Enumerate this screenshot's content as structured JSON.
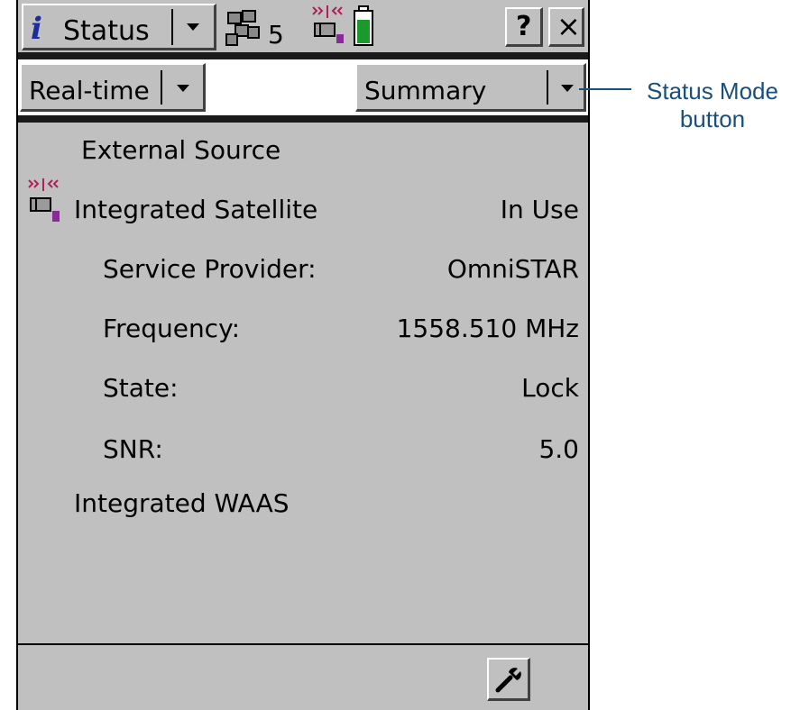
{
  "titlebar": {
    "app_label": "Status",
    "satellite_count": "5",
    "help_label": "?",
    "close_label": "×"
  },
  "toolbar": {
    "mode_left": "Real-time",
    "mode_right": "Summary"
  },
  "content": {
    "external_source": "External Source",
    "integrated_satellite": {
      "label": "Integrated Satellite",
      "status": "In Use",
      "rows": [
        {
          "label": "Service Provider:",
          "value": "OmniSTAR"
        },
        {
          "label": "Frequency:",
          "value": "1558.510 MHz"
        },
        {
          "label": "State:",
          "value": "Lock"
        },
        {
          "label": "SNR:",
          "value": "5.0"
        }
      ]
    },
    "integrated_waas": "Integrated WAAS"
  },
  "callout": {
    "line1": "Status Mode",
    "line2": "button"
  },
  "colors": {
    "background": "#c0c0c0",
    "callout": "#1a4f7a",
    "battery": "#1a9a2a",
    "app_icon": "#1c2c9c"
  },
  "icons": [
    "info-icon",
    "dropdown-arrow-icon",
    "satellites-icon",
    "radio-receiver-icon",
    "battery-icon",
    "help-icon",
    "close-icon",
    "wrench-icon"
  ]
}
